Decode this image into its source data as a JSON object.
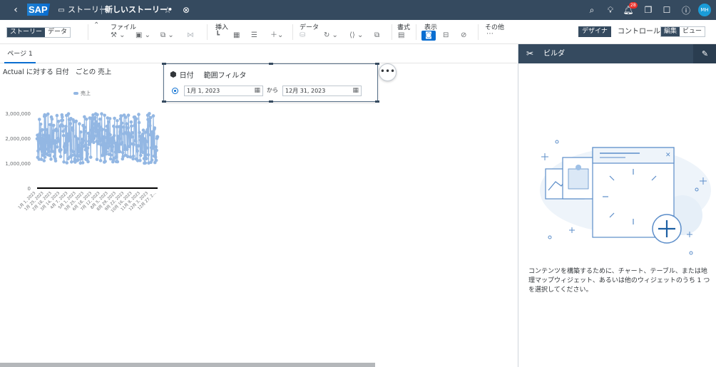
{
  "topbar": {
    "back_icon": "chevron-left-icon",
    "logo_text": "SAP",
    "story_icon": "presentation-icon",
    "story_label": "ストーリー",
    "story_name": "新しいストーリー•",
    "notifications_count": "28",
    "avatar_initials": "MH",
    "bg_color": "#354a5f"
  },
  "toolbar": {
    "mode_story": "ストーリー",
    "mode_data": "データ",
    "group_file": "ファイル",
    "group_insert": "挿入",
    "group_data": "データ",
    "group_format": "書式",
    "group_view": "表示",
    "group_more": "その他",
    "designer_label": "デザイナ",
    "control_label": "コントロール",
    "edit_label": "編集",
    "view_label": "ビュー"
  },
  "page": {
    "tab_label": "ページ 1"
  },
  "chart": {
    "title": "Actual に対する 日付   ごとの 売上",
    "legend_label": "売上"
  },
  "chart_data": {
    "type": "line",
    "title": "Actual に対する 日付   ごとの 売上",
    "series": [
      {
        "name": "売上",
        "color": "#93b7e3",
        "range": [
          1000000,
          3000000
        ]
      }
    ],
    "y_ticks": [
      "3,000,000",
      "2,000,000",
      "1,000,000",
      "0"
    ],
    "ylim": [
      0,
      3000000
    ],
    "x_tick_labels": [
      "1月 1, 2023",
      "1月 25, 2023",
      "2月 18, 2023",
      "3月 14, 2023",
      "4月 7, 2023",
      "5月 1, 2023",
      "5月 25, 2023",
      "6月 18, 2023",
      "7月 12, 2023",
      "8月 5, 2023",
      "8月 29, 2023",
      "9月 22, 2023",
      "10月 16, 2023",
      "11月 9, 2023",
      "12月 3, 2023",
      "12月 27, 2..."
    ],
    "legend": "top"
  },
  "filter": {
    "title_label": "日付",
    "type_label": "範囲フィルタ",
    "from_date": "1月 1, 2023",
    "to_label": "から",
    "to_date": "12月 31, 2023"
  },
  "builder": {
    "title": "ビルダ",
    "message": "コンテンツを構築するために、チャート、テーブル、または地理マップウィジェット、あるいは他のウィジェットのうち 1 つを選択してください。"
  }
}
